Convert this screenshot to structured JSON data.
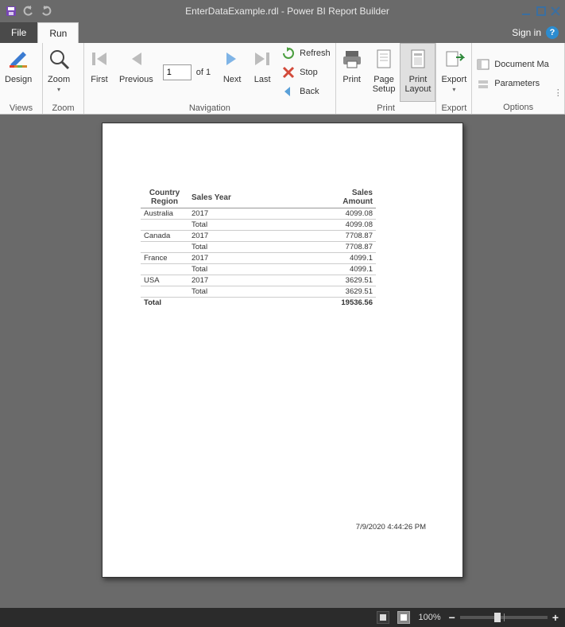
{
  "window": {
    "title": "EnterDataExample.rdl - Power BI Report Builder"
  },
  "tabs": {
    "file": "File",
    "run": "Run",
    "signin": "Sign in"
  },
  "ribbon": {
    "views": {
      "group": "Views",
      "design": "Design"
    },
    "zoom": {
      "group": "Zoom",
      "zoom": "Zoom"
    },
    "nav": {
      "group": "Navigation",
      "first": "First",
      "previous": "Previous",
      "next": "Next",
      "last": "Last",
      "current_page": "1",
      "of": "of  1",
      "refresh": "Refresh",
      "stop": "Stop",
      "back": "Back"
    },
    "print": {
      "group": "Print",
      "print": "Print",
      "page_setup": "Page\nSetup",
      "print_layout": "Print\nLayout"
    },
    "export": {
      "group": "Export",
      "export": "Export"
    },
    "options": {
      "group": "Options",
      "document_map": "Document Ma",
      "parameters": "Parameters"
    }
  },
  "report": {
    "headers": {
      "country": "Country\nRegion",
      "year": "Sales Year",
      "amount": "Sales\nAmount"
    },
    "subtotal_label": "Total",
    "grand_total_label": "Total",
    "groups": [
      {
        "country": "Australia",
        "rows": [
          {
            "year": "2017",
            "amount": "4099.08"
          }
        ],
        "subtotal": "4099.08"
      },
      {
        "country": "Canada",
        "rows": [
          {
            "year": "2017",
            "amount": "7708.87"
          }
        ],
        "subtotal": "7708.87"
      },
      {
        "country": "France",
        "rows": [
          {
            "year": "2017",
            "amount": "4099.1"
          }
        ],
        "subtotal": "4099.1"
      },
      {
        "country": "USA",
        "rows": [
          {
            "year": "2017",
            "amount": "3629.51"
          }
        ],
        "subtotal": "3629.51"
      }
    ],
    "grand_total": "19536.56",
    "timestamp": "7/9/2020 4:44:26 PM"
  },
  "status": {
    "zoom_pct": "100%"
  }
}
